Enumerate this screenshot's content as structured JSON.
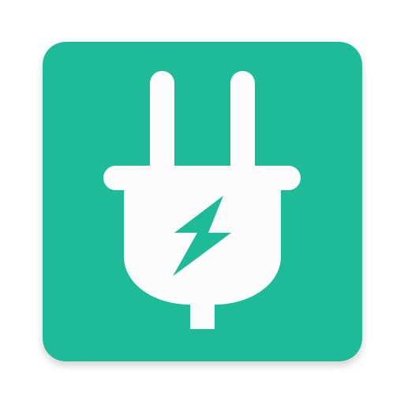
{
  "app_icon": {
    "name": "power-plug-app-icon",
    "background_color": "#1DBB98",
    "glyph_color": "#FCFCFC",
    "bolt_color": "#1DBB98",
    "icon": "power-plug-icon",
    "bolt_icon": "lightning-bolt-icon"
  }
}
